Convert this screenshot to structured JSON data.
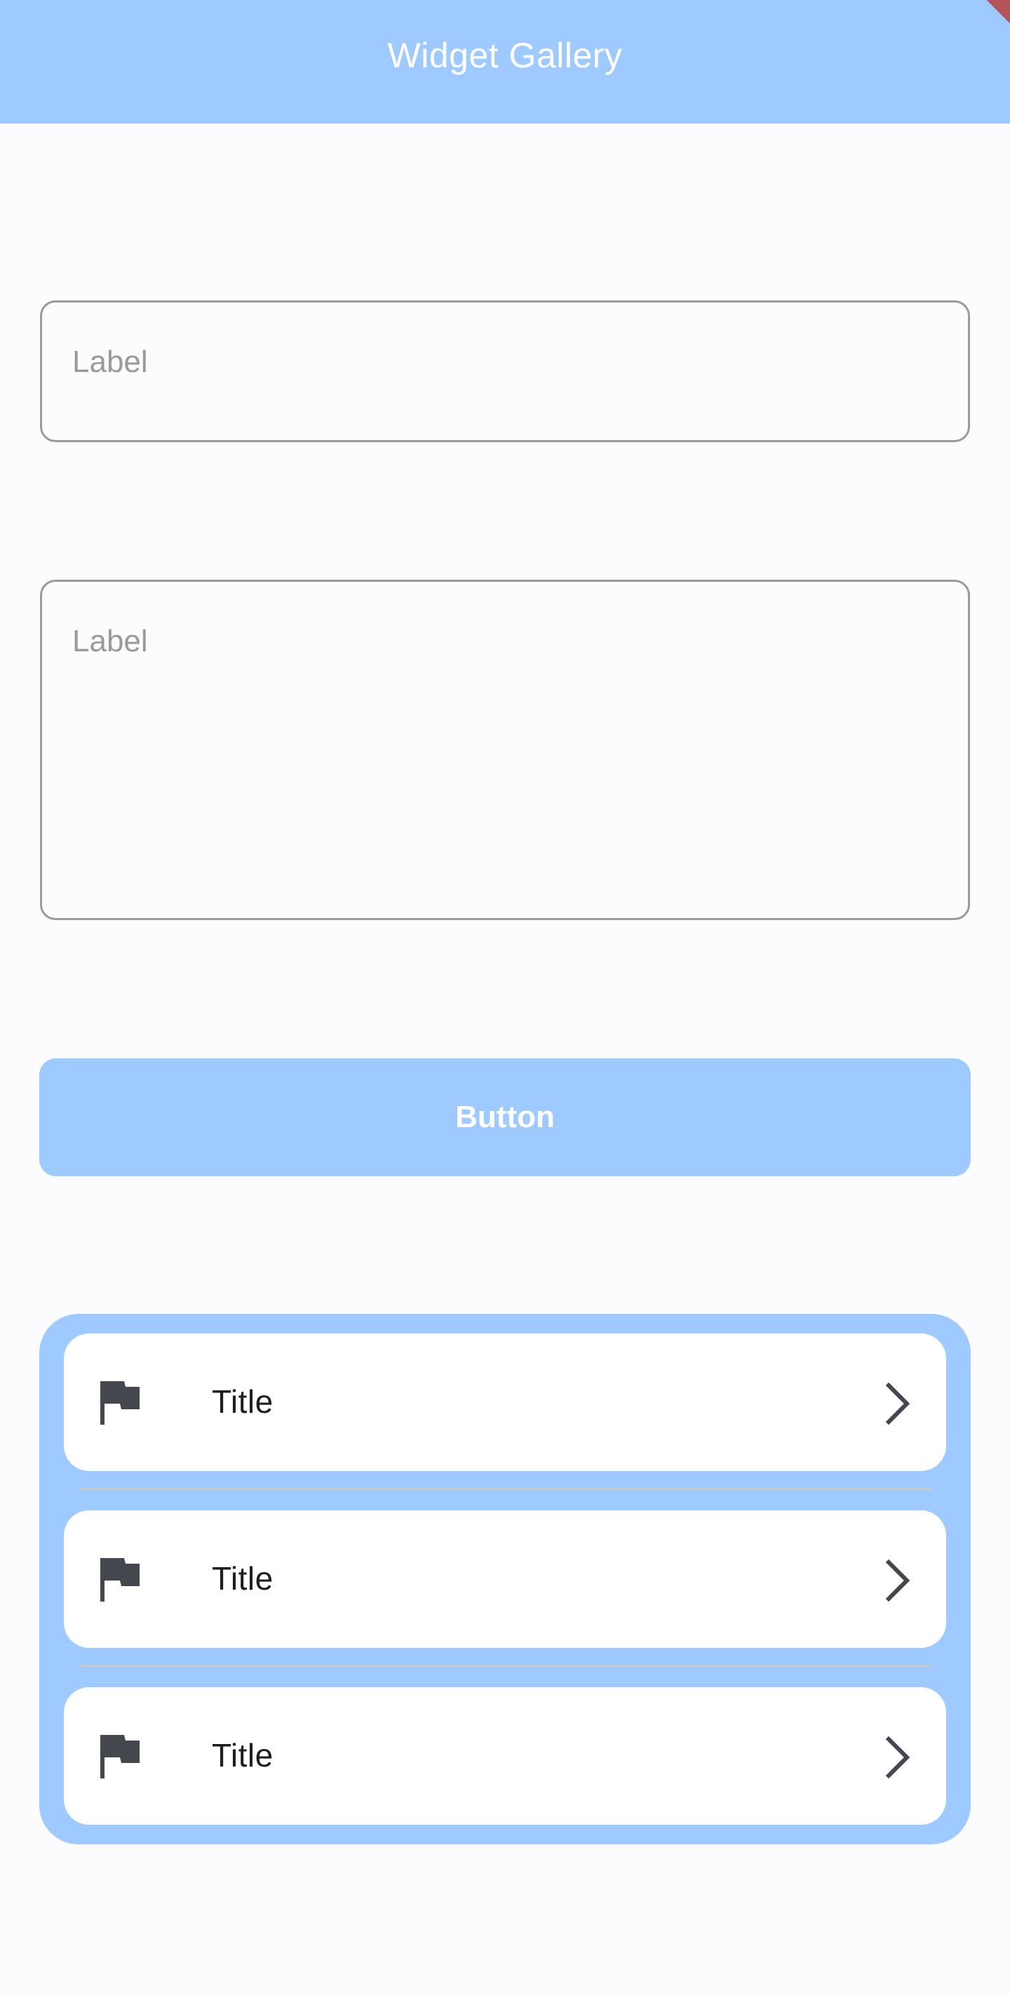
{
  "app_bar": {
    "title": "Widget Gallery"
  },
  "text_field": {
    "label": "Label"
  },
  "text_area": {
    "label": "Label"
  },
  "button": {
    "label": "Button"
  },
  "list": {
    "items": [
      {
        "title": "Title",
        "icon": "flag-icon",
        "trailing_icon": "chevron-right-icon"
      },
      {
        "title": "Title",
        "icon": "flag-icon",
        "trailing_icon": "chevron-right-icon"
      },
      {
        "title": "Title",
        "icon": "flag-icon",
        "trailing_icon": "chevron-right-icon"
      }
    ]
  },
  "colors": {
    "primary": "#9fcaff",
    "background": "#fcfbfe",
    "icon": "#44474e",
    "outline": "#9a9a9a",
    "debug_banner": "#b4535a"
  }
}
